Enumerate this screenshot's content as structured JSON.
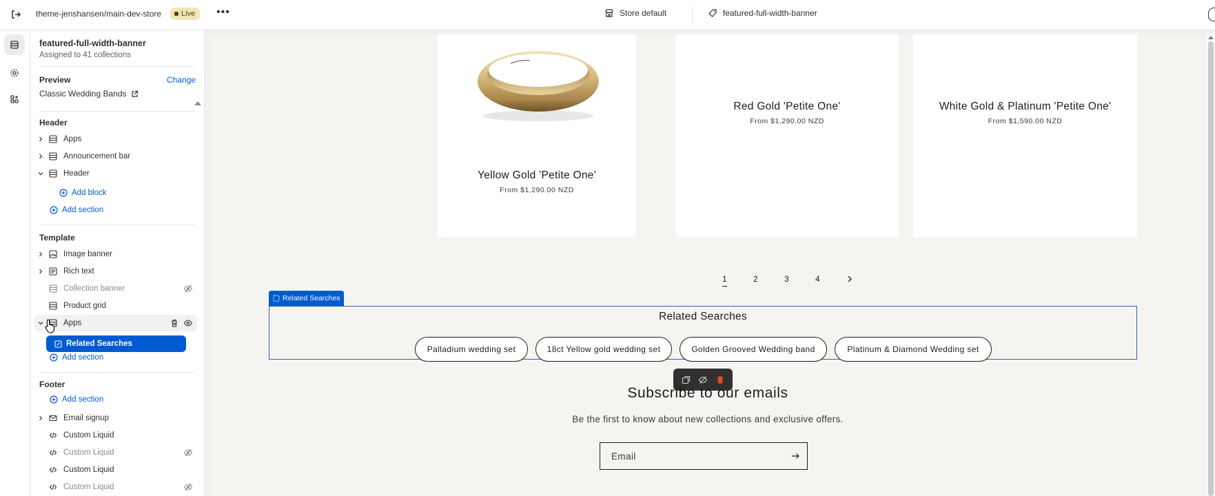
{
  "topbar": {
    "theme_name": "theme-jenshansen/main-dev-store",
    "live_label": "Live",
    "store_label": "Store default",
    "template_label": "featured-full-width-banner"
  },
  "sidebar": {
    "title": "featured-full-width-banner",
    "subtitle": "Assigned to 41 collections",
    "preview_label": "Preview",
    "change_label": "Change",
    "preview_value": "Classic Wedding Bands",
    "header_group": "Header",
    "header_items": [
      "Apps",
      "Announcement bar",
      "Header"
    ],
    "add_block": "Add block",
    "add_section": "Add section",
    "template_group": "Template",
    "template_items": [
      "Image banner",
      "Rich text",
      "Collection banner",
      "Product grid",
      "Apps"
    ],
    "selected_block": "Related Searches",
    "footer_group": "Footer",
    "footer_items": [
      "Email signup",
      "Custom Liquid",
      "Custom Liquid",
      "Custom Liquid",
      "Custom Liquid"
    ]
  },
  "products": [
    {
      "title": "Yellow Gold 'Petite One'",
      "price": "From $1,290.00 NZD"
    },
    {
      "title": "Red Gold 'Petite One'",
      "price": "From $1,290.00 NZD"
    },
    {
      "title": "White Gold & Platinum 'Petite One'",
      "price": "From $1,590.00 NZD"
    }
  ],
  "pagination": [
    "1",
    "2",
    "3",
    "4"
  ],
  "related": {
    "tag": "Related Searches",
    "heading": "Related Searches",
    "chips": [
      "Palladium wedding set",
      "18ct Yellow gold wedding set",
      "Golden Grooved Wedding band",
      "Platinum & Diamond Wedding set"
    ]
  },
  "subscribe": {
    "title": "Subscribe to our emails",
    "text": "Be the first to know about new collections and exclusive offers.",
    "email_placeholder": "Email"
  },
  "colors": {
    "accent": "#005bd3",
    "live_badge": "#f1e6b8",
    "preview_bg": "#f5f4f0"
  }
}
